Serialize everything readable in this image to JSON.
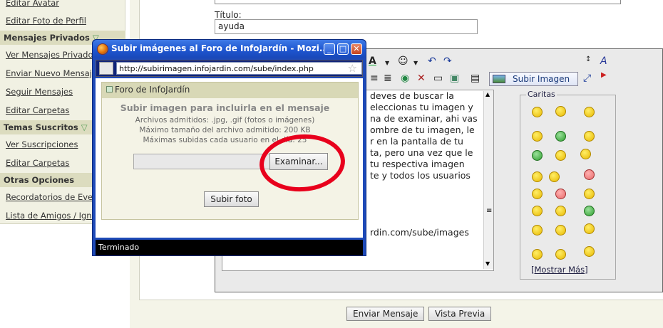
{
  "sidebar": {
    "items_top": [
      {
        "label": "Editar Avatar"
      },
      {
        "label": "Editar Foto de Perfil"
      }
    ],
    "section_mp": "Mensajes Privados",
    "items_mp": [
      {
        "label": "Ver Mensajes Privados"
      },
      {
        "label": "Enviar Nuevo Mensaje"
      },
      {
        "label": "Seguir Mensajes"
      },
      {
        "label": "Editar Carpetas"
      }
    ],
    "section_ts": "Temas Suscritos",
    "items_ts": [
      {
        "label": "Ver Suscripciones"
      },
      {
        "label": "Editar Carpetas"
      }
    ],
    "section_oo": "Otras Opciones",
    "items_oo": [
      {
        "label": "Recordatorios de Eventos"
      },
      {
        "label": "Lista de Amigos / Ignorados"
      }
    ],
    "arrow": "▽"
  },
  "form": {
    "title_label": "Título:",
    "title_value": "ayuda"
  },
  "editor": {
    "subir_imagen": "Subir Imagen",
    "text_lines": [
      "deves de buscar la",
      "eleccionas tu imagen y",
      "na de examinar, ahi vas",
      "ombre de tu imagen, le",
      "r en la pantalla de tu",
      "ta, pero una vez que le",
      "tu respectiva imagen",
      "te y todos los usuarios",
      "rdin.com/sube/images"
    ],
    "caritas_label": "Caritas",
    "mostrar_open": "[",
    "mostrar_mas": "Mostrar Más",
    "mostrar_close": "]"
  },
  "buttons": {
    "enviar": "Enviar Mensaje",
    "vista": "Vista Previa"
  },
  "popup": {
    "title": "Subir imágenes al Foro de InfoJardín - Mozi...",
    "url": "http://subirimagen.infojardin.com/sube/index.php",
    "bar": "Foro de InfoJardín",
    "heading": "Subir imagen para incluirla en el mensaje",
    "line1": "Archivos admitidos: .jpg, .gif (fotos o imágenes)",
    "line2": "Máximo tamaño del archivo admitido: 200 KB",
    "line3": "Máximas subidas cada usuario en el día: 25",
    "examinar": "Examinar...",
    "subir_foto": "Subir foto",
    "status": "Terminado"
  },
  "colors": {
    "annotation": "#e8001c",
    "titlebar": "#1e56d0"
  }
}
